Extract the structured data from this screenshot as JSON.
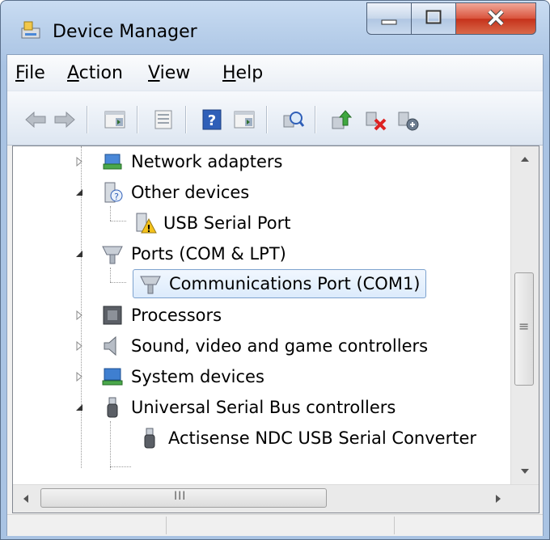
{
  "window": {
    "title": "Device Manager"
  },
  "menu": [
    {
      "access_key": "F",
      "rest": "ile"
    },
    {
      "access_key": "A",
      "rest": "ction"
    },
    {
      "access_key": "V",
      "rest": "iew"
    },
    {
      "access_key": "H",
      "rest": "elp"
    }
  ],
  "toolbar": {
    "icons": [
      "back-icon",
      "forward-icon",
      "properties-grid-icon",
      "show-hide-console-tree-icon",
      "help-icon",
      "action-pane-icon",
      "scan-hardware-icon",
      "update-driver-icon",
      "disable-device-icon",
      "uninstall-device-icon"
    ]
  },
  "tree": {
    "items": [
      {
        "label": "Network adapters",
        "state": "collapsed"
      },
      {
        "label": "Other devices",
        "state": "expanded"
      },
      {
        "label": "USB Serial Port",
        "state": "leaf"
      },
      {
        "label": "Ports (COM & LPT)",
        "state": "expanded"
      },
      {
        "label": "Communications Port (COM1)",
        "state": "leaf-selected"
      },
      {
        "label": "Processors",
        "state": "collapsed"
      },
      {
        "label": "Sound, video and game controllers",
        "state": "collapsed"
      },
      {
        "label": "System devices",
        "state": "collapsed"
      },
      {
        "label": "Universal Serial Bus controllers",
        "state": "expanded"
      },
      {
        "label": "Actisense NDC USB Serial Converter",
        "state": "leaf"
      }
    ]
  },
  "scrollbar": {
    "vertical_grip": "≡",
    "horizontal_grip": "III"
  },
  "colors": {
    "selection_border": "#7da2ce",
    "close_button": "#c6321b"
  }
}
